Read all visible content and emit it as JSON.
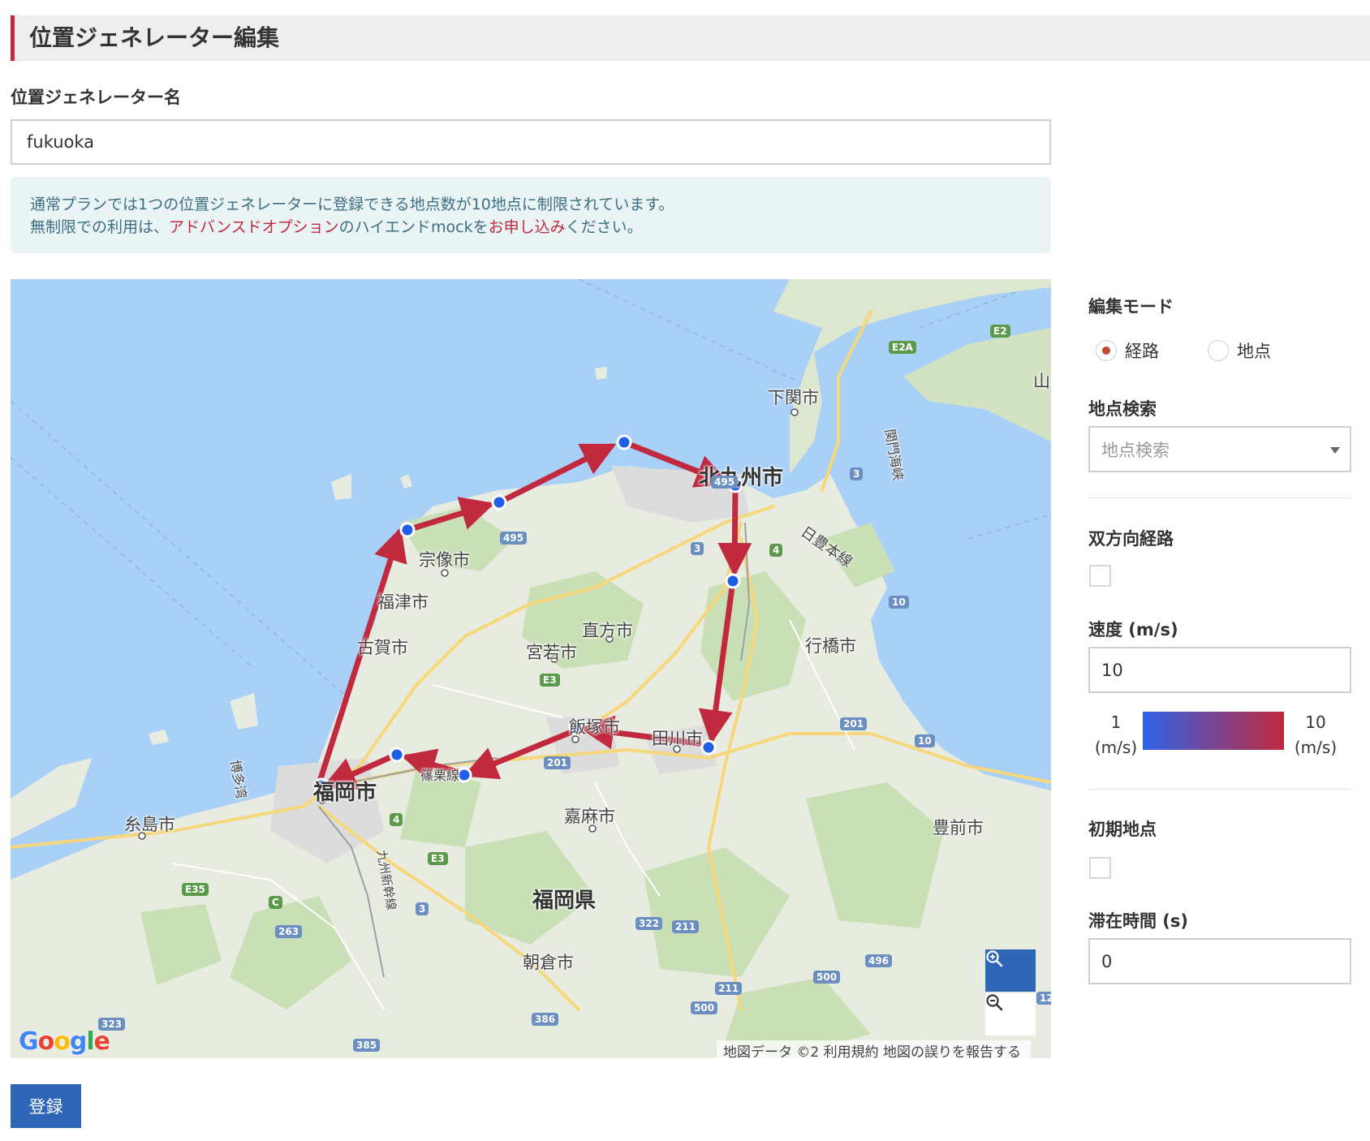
{
  "page": {
    "title": "位置ジェネレーター編集"
  },
  "name_field": {
    "label": "位置ジェネレーター名",
    "value": "fukuoka"
  },
  "notice": {
    "line1": "通常プランでは1つの位置ジェネレーターに登録できる地点数が10地点に制限されています。",
    "line2_prefix": "無制限での利用は、",
    "line2_link1": "アドバンスドオプション",
    "line2_middle": "のハイエンドmockを",
    "line2_link2": "お申し込み",
    "line2_suffix": "ください。"
  },
  "map": {
    "labels": {
      "kitakyushu": "北九州市",
      "shimonoseki": "下関市",
      "munakata": "宗像市",
      "fukutsu": "福津市",
      "koga": "古賀市",
      "miyawaka": "宮若市",
      "nogata": "直方市",
      "yukuhashi": "行橋市",
      "iizuka": "飯塚市",
      "tagawa": "田川市",
      "fukuoka_city": "福岡市",
      "itoshima": "糸島市",
      "kama": "嘉麻市",
      "fukuoka_pref": "福岡県",
      "asakura": "朝倉市",
      "buzen": "豊前市",
      "nippo_line": "日豊本線",
      "hakata_bay": "博多湾",
      "shinkansen": "九州新幹線",
      "kanmon": "関門海峡",
      "sasaguri_line": "篠栗線",
      "yamaguchi": "山"
    },
    "shields": [
      "E2A",
      "E2",
      "495",
      "495",
      "3",
      "4",
      "10",
      "E3",
      "201",
      "10",
      "201",
      "4",
      "E3",
      "E35",
      "C",
      "263",
      "3",
      "322",
      "211",
      "496",
      "500",
      "211",
      "500",
      "386",
      "323",
      "385",
      "12",
      "3"
    ],
    "google_logo": "Google",
    "attribution": "地図データ ©2 利用規約 地図の誤りを報告する",
    "route_color": "#c0293e",
    "waypoint_color": "#1f5fe8"
  },
  "sidebar": {
    "edit_mode": {
      "label": "編集モード",
      "options": [
        {
          "label": "経路",
          "selected": true
        },
        {
          "label": "地点",
          "selected": false
        }
      ]
    },
    "search": {
      "label": "地点検索",
      "placeholder": "地点検索"
    },
    "bidirectional": {
      "label": "双方向経路",
      "checked": false
    },
    "speed": {
      "label": "速度 (m/s)",
      "value": "10",
      "legend_min": "1",
      "legend_max": "10",
      "legend_unit": "(m/s)",
      "color_min": "#2f63e8",
      "color_max": "#c0293e"
    },
    "initial_point": {
      "label": "初期地点",
      "checked": false
    },
    "stay_time": {
      "label": "滞在時間 (s)",
      "value": "0"
    }
  },
  "submit_label": "登録"
}
